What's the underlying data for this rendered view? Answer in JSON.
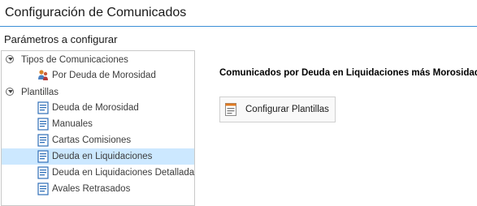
{
  "window": {
    "title": "Configuración de Comunicados"
  },
  "params": {
    "label": "Parámetros a configurar"
  },
  "tree": {
    "groups": [
      {
        "label": "Tipos de Comunicaciones",
        "expanded": true,
        "items": [
          {
            "label": "Por Deuda de Morosidad",
            "icon": "people-alert-icon",
            "selected": false
          }
        ]
      },
      {
        "label": "Plantillas",
        "expanded": true,
        "items": [
          {
            "label": "Deuda de Morosidad",
            "icon": "document-icon",
            "selected": false
          },
          {
            "label": "Manuales",
            "icon": "document-icon",
            "selected": false
          },
          {
            "label": "Cartas Comisiones",
            "icon": "document-icon",
            "selected": false
          },
          {
            "label": "Deuda en Liquidaciones",
            "icon": "document-icon",
            "selected": true
          },
          {
            "label": "Deuda en Liquidaciones Detallada",
            "icon": "document-icon",
            "selected": false
          },
          {
            "label": "Avales Retrasados",
            "icon": "document-icon",
            "selected": false
          }
        ]
      }
    ]
  },
  "content": {
    "heading": "Comunicados por Deuda en Liquidaciones más Morosidad.",
    "button_label": "Configurar Plantillas",
    "button_icon": "template-list-icon"
  },
  "colors": {
    "title_border": "#3b8fd6",
    "selection": "#cce8ff",
    "doc_icon": "#2f6fb8"
  }
}
